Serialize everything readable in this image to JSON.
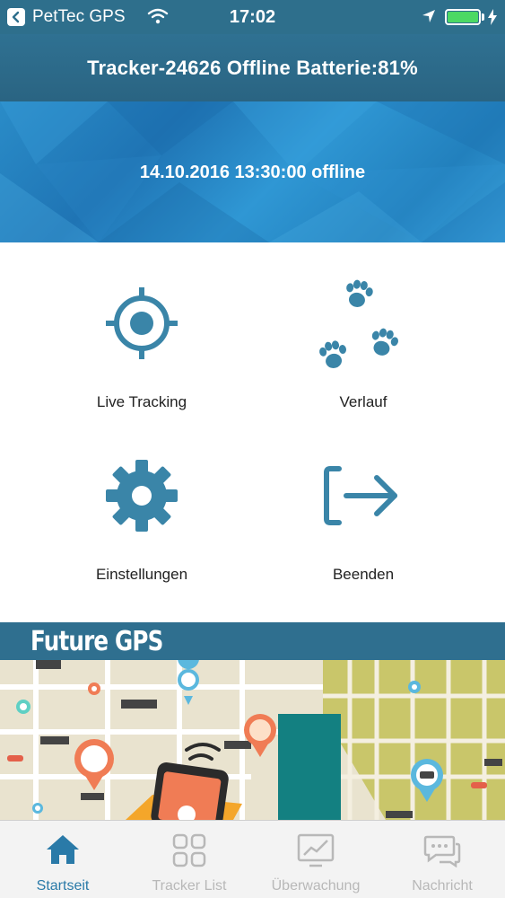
{
  "status_bar": {
    "app_name": "PetTec GPS",
    "time": "17:02",
    "battery_level_percent": 100,
    "battery_color": "#4cd964"
  },
  "header": {
    "title": "Tracker-24626 Offline Batterie:81%"
  },
  "banner": {
    "status_text": "14.10.2016 13:30:00 offline"
  },
  "menu": {
    "items": [
      {
        "label": "Live Tracking",
        "icon": "crosshair-icon"
      },
      {
        "label": "Verlauf",
        "icon": "paw-prints-icon"
      },
      {
        "label": "Einstellungen",
        "icon": "gear-icon"
      },
      {
        "label": "Beenden",
        "icon": "logout-icon"
      }
    ]
  },
  "promo": {
    "title": "Future GPS"
  },
  "tab_bar": {
    "tabs": [
      {
        "label": "Startseit",
        "icon": "home-icon",
        "active": true
      },
      {
        "label": "Tracker List",
        "icon": "grid-icon",
        "active": false
      },
      {
        "label": "Überwachung",
        "icon": "chart-monitor-icon",
        "active": false
      },
      {
        "label": "Nachricht",
        "icon": "chat-bubbles-icon",
        "active": false
      }
    ]
  },
  "colors": {
    "primary": "#2e6f8c",
    "icon_blue": "#3a85a8",
    "active_tab": "#2a7aa8",
    "inactive_tab": "#b8b8b8"
  }
}
